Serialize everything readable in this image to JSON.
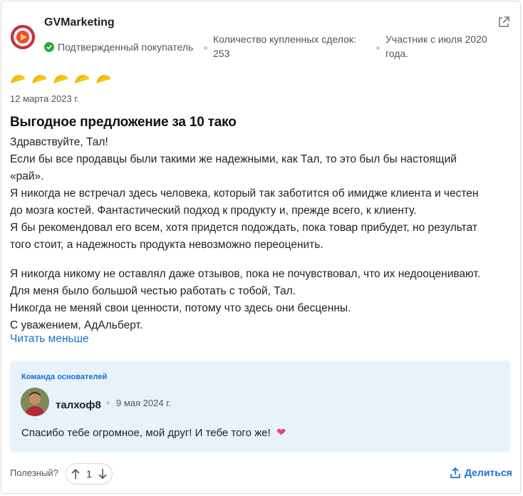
{
  "review": {
    "author": {
      "name": "GVMarketing",
      "verified_label": "Подтвержденный покупатель",
      "deals_label": "Количество купленных сделок:",
      "deals_count": "253",
      "member_since_line1": "Участник с июля 2020",
      "member_since_line2": "года."
    },
    "rating": 5,
    "date": "12 марта 2023 г.",
    "title": "Выгодное предложение за 10 тако",
    "body_lines": [
      "Здравствуйте, Тал!",
      "Если бы все продавцы были такими же надежными, как Тал, то это был бы настоящий",
      "«рай».",
      "Я никогда не встречал здесь человека, который так заботится об имидже клиента и честен",
      "до мозга костей. Фантастический подход к продукту и, прежде всего, к клиенту.",
      "Я бы рекомендовал его всем, хотя придется подождать, пока товар прибудет, но результат",
      "того стоит, а надежность продукта невозможно переоценить."
    ],
    "body_lines_2": [
      "Я никогда никому не оставлял даже отзывов, пока не почувствовал, что их недооценивают.",
      "Для меня было большой честью работать с тобой, Тал.",
      "Никогда не меняй свои ценности, потому что здесь они бесценны.",
      "С уважением, АдАльберт."
    ],
    "read_less": "Читать меньше"
  },
  "reply": {
    "team_label": "Команда основателей",
    "name": "талхоф8",
    "date": "9 мая 2024 г.",
    "text": "Спасибо тебе огромное, мой друг! И тебе того же!"
  },
  "footer": {
    "helpful_label": "Полезный?",
    "vote_count": "1",
    "share_label": "Делиться"
  },
  "colors": {
    "accent": "#1a6fd1",
    "verified": "#2dab3c",
    "star": "#f5c518",
    "reply_bg": "#e7f2fb",
    "heart": "#e0457b"
  },
  "icons": [
    "external-link-icon",
    "check-circle-icon",
    "taco-star-icon",
    "arrow-up-icon",
    "arrow-down-icon",
    "share-icon",
    "heart-icon"
  ]
}
